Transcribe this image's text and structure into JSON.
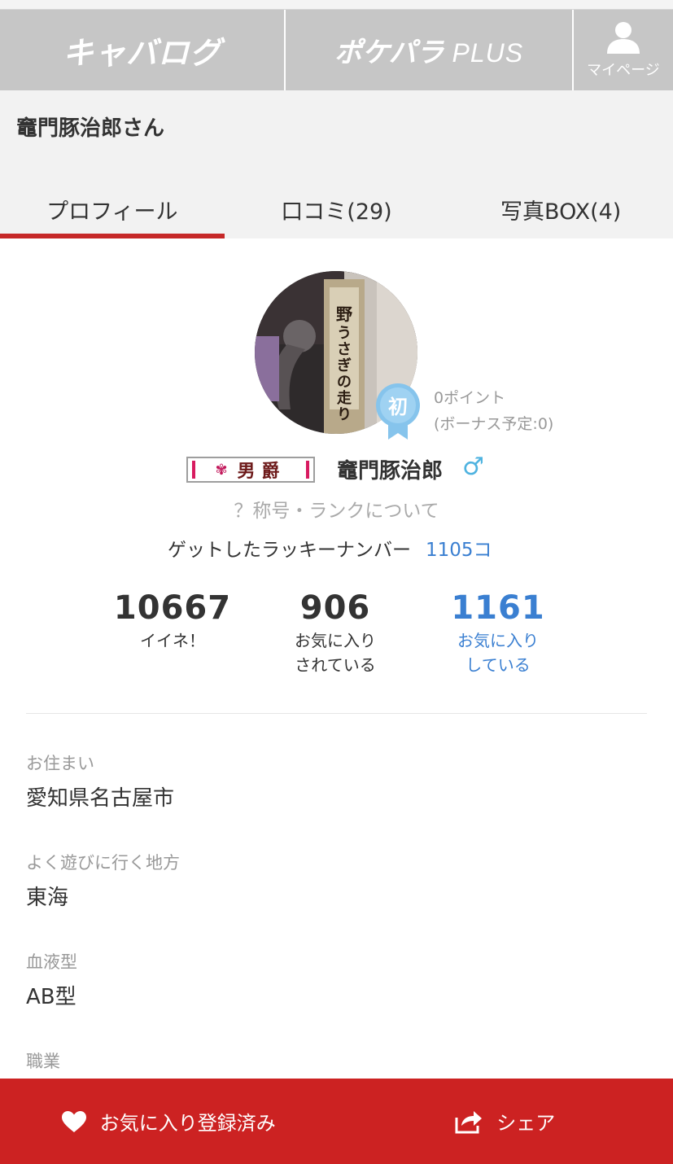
{
  "header": {
    "logo_left": "キャバログ",
    "logo_center": "ポケパラ",
    "logo_center_suffix": "PLUS",
    "mypage_label": "マイページ"
  },
  "user_header": {
    "title": "竈門豚治郎さん"
  },
  "tabs": [
    {
      "label": "プロフィール",
      "active": true
    },
    {
      "label": "口コミ(29)",
      "active": false
    },
    {
      "label": "写真BOX(4)",
      "active": false
    }
  ],
  "profile": {
    "badge_label": "初",
    "points": "0ポイント",
    "bonus": "(ボーナス予定:0)",
    "rank_plate": "男爵",
    "display_name": "竈門豚治郎",
    "gender_symbol": "♂",
    "rank_link": "？称号・ランクについて",
    "lucky_label": "ゲットしたラッキーナンバー",
    "lucky_value": "1105コ"
  },
  "stats": [
    {
      "value": "10667",
      "label_line1": "イイネ！",
      "label_line2": ""
    },
    {
      "value": "906",
      "label_line1": "お気に入り",
      "label_line2": "されている"
    },
    {
      "value": "1161",
      "label_line1": "お気に入り",
      "label_line2": "している"
    }
  ],
  "details": [
    {
      "key": "お住まい",
      "value": "愛知県名古屋市"
    },
    {
      "key": "よく遊びに行く地方",
      "value": "東海"
    },
    {
      "key": "血液型",
      "value": "AB型"
    },
    {
      "key": "職業",
      "value": ""
    }
  ],
  "bottom_bar": {
    "favorite_label": "お気に入り登録済み",
    "share_label": "シェア"
  },
  "colors": {
    "accent_red": "#cc2222",
    "link_blue": "#3a7fd1",
    "header_gray": "#c6c6c6"
  }
}
